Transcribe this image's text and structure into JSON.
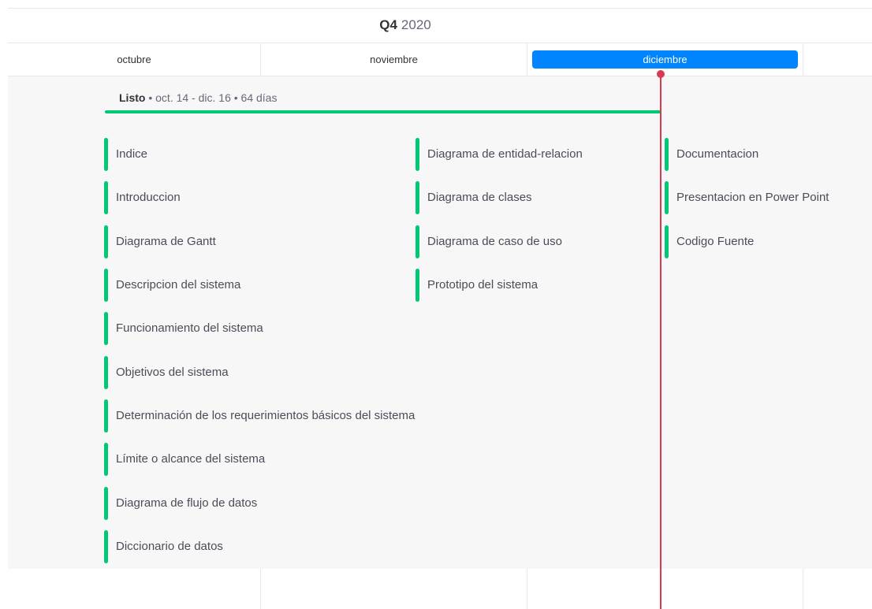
{
  "timeline": {
    "quarter_label": "Q4",
    "year_label": "2020",
    "months": [
      "octubre",
      "noviembre",
      "diciembre"
    ],
    "active_month": "diciembre"
  },
  "group": {
    "status_label": "Listo",
    "date_range": "oct. 14 - dic. 16",
    "duration": "64 días",
    "separator": "•",
    "color": "#00c875"
  },
  "items": {
    "col1": [
      "Indice",
      "Introduccion",
      "Diagrama de Gantt",
      "Descripcion del sistema",
      "Funcionamiento del sistema",
      "Objetivos del sistema",
      "Determinación de los requerimientos básicos del sistema",
      "Límite o alcance del sistema",
      "Diagrama de flujo de datos",
      "Diccionario de datos"
    ],
    "col2": [
      "Diagrama de entidad-relacion",
      "Diagrama de clases",
      "Diagrama de caso de uso",
      "Prototipo del sistema"
    ],
    "col3": [
      "Documentacion",
      "Presentacion en Power Point",
      "Codigo Fuente"
    ]
  },
  "colors": {
    "active_month_bg": "#0085ff",
    "today_marker": "#d83a52",
    "status_green": "#00c875"
  }
}
